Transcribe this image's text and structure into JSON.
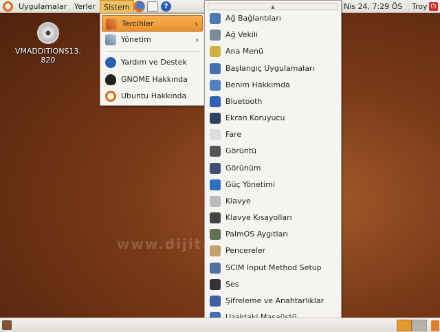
{
  "top_panel": {
    "menus": [
      "Uygulamalar",
      "Yerler",
      "Sistem"
    ],
    "clock": "Nis 24,  7:29 ÖS",
    "user": "Troy"
  },
  "desktop": {
    "icon_label": "VMADDITIONS13.\n820"
  },
  "watermark": "www.dijita",
  "sistem_menu": {
    "items": [
      {
        "label": "Tercihler",
        "icon": "preferences-icon",
        "submenu": true,
        "highlighted": true
      },
      {
        "label": "Yönetim",
        "icon": "administration-icon",
        "submenu": true
      },
      {
        "label": "Yardım ve Destek",
        "icon": "help-icon"
      },
      {
        "label": "GNOME Hakkında",
        "icon": "gnome-foot-icon"
      },
      {
        "label": "Ubuntu Hakkında",
        "icon": "ubuntu-logo-icon"
      }
    ]
  },
  "tercihler_menu": {
    "items": [
      "Ağ Bağlantıları",
      "Ağ Vekili",
      "Ana Menü",
      "Başlangıç Uygulamaları",
      "Benim Hakkımda",
      "Bluetooth",
      "Ekran Koruyucu",
      "Fare",
      "Görüntü",
      "Görünüm",
      "Güç Yönetimi",
      "Klavye",
      "Klavye Kısayolları",
      "PalmOS Aygıtları",
      "Pencereler",
      "SCIM Input Method Setup",
      "Ses",
      "Şifreleme ve Anahtarlıklar",
      "Uzaktaki Masaüstü"
    ]
  },
  "colors": {
    "highlight": "#f0a040",
    "panel": "#ece9e4",
    "accent_orange": "#dd8833"
  }
}
